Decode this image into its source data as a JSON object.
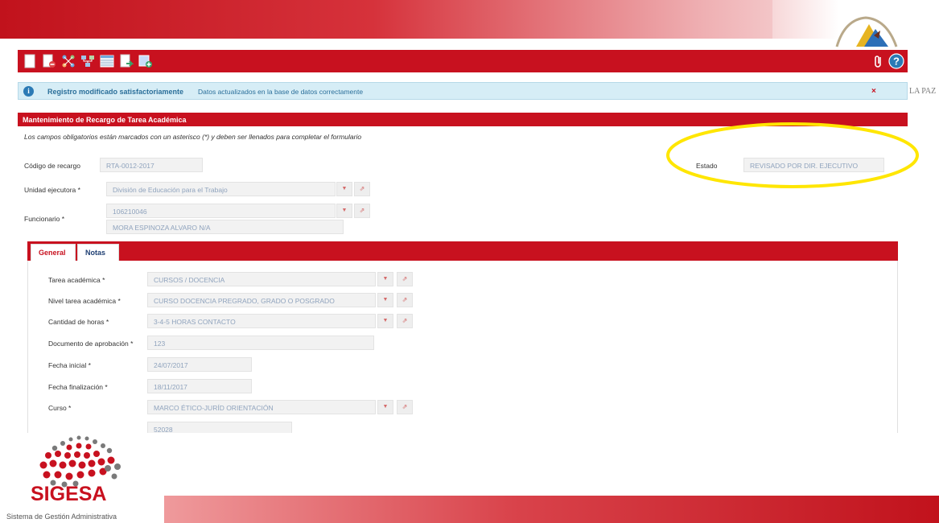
{
  "slide": {
    "side_text": "LA PAZ",
    "logo": {
      "title": "SIGESA",
      "subtitle": "Sistema de Gestión Administrativa"
    },
    "colors": {
      "brand_red": "#c8111f",
      "highlight": "#ffe600"
    }
  },
  "toolbar": {
    "left_icons": [
      "new-document-icon",
      "delete-document-icon",
      "workflow-icon",
      "tree-structure-icon",
      "table-list-icon",
      "export-document-icon",
      "add-record-icon"
    ],
    "right_icons": [
      "attachment-icon",
      "help-icon"
    ]
  },
  "alert": {
    "icon": "info-icon",
    "title": "Registro modificado satisfactoriamente",
    "message": "Datos actualizados en la base de datos correctamente",
    "close": "×"
  },
  "form": {
    "section_title": "Mantenimiento de Recargo de Tarea Académica",
    "required_note": "Los campos obligatorios están marcados con un asterisco (*) y deben ser llenados para completar el formulario",
    "codigo": {
      "label": "Código de recargo",
      "value": "RTA-0012-2017"
    },
    "estado": {
      "label": "Estado",
      "value": "REVISADO POR DIR. EJECUTIVO"
    },
    "unidad": {
      "label": "Unidad ejecutora *",
      "value": "División de Educación para el Trabajo"
    },
    "funcionario": {
      "label": "Funcionario *",
      "id": "106210046",
      "name": "MORA  ESPINOZA ALVARO N/A"
    }
  },
  "tabs": [
    {
      "label": "General",
      "active": true
    },
    {
      "label": "Notas",
      "active": false
    }
  ],
  "general": {
    "tarea": {
      "label": "Tarea académica *",
      "value": "CURSOS / DOCENCIA"
    },
    "nivel": {
      "label": "Nivel tarea académica *",
      "value": "CURSO DOCENCIA PREGRADO, GRADO O POSGRADO"
    },
    "horas": {
      "label": "Cantidad de horas *",
      "value": "3-4-5 HORAS CONTACTO"
    },
    "documento": {
      "label": "Documento de aprobación *",
      "value": "123"
    },
    "fecha_inicial": {
      "label": "Fecha inicial *",
      "value": "24/07/2017"
    },
    "fecha_final": {
      "label": "Fecha finalización *",
      "value": "18/11/2017"
    },
    "curso": {
      "label": "Curso *",
      "value": "MARCO ÉTICO-JURÍD ORIENTACIÓN"
    },
    "siguiente": {
      "value": "52028"
    }
  }
}
